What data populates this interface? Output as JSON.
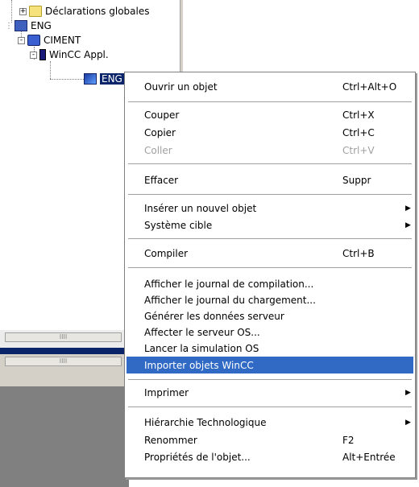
{
  "tree": {
    "nodes": [
      {
        "label": "Déclarations globales"
      },
      {
        "label": "ENG"
      },
      {
        "label": "CIMENT"
      },
      {
        "label": "WinCC Appl."
      },
      {
        "label": "ENG"
      }
    ],
    "expanders": [
      "+",
      "-",
      "-"
    ]
  },
  "panes": {
    "scroll_marks": [
      "IIII",
      "IIII"
    ]
  },
  "context_menu": {
    "items": [
      {
        "label": "Ouvrir un objet",
        "shortcut": "Ctrl+Alt+O"
      },
      {
        "label": "Couper",
        "shortcut": "Ctrl+X"
      },
      {
        "label": "Copier",
        "shortcut": "Ctrl+C"
      },
      {
        "label": "Coller",
        "shortcut": "Ctrl+V"
      },
      {
        "label": "Effacer",
        "shortcut": "Suppr"
      },
      {
        "label": "Insérer un nouvel objet",
        "arrow": "▶"
      },
      {
        "label": "Système cible",
        "arrow": "▶"
      },
      {
        "label": "Compiler",
        "shortcut": "Ctrl+B"
      },
      {
        "label": "Afficher le journal de compilation..."
      },
      {
        "label": "Afficher le journal du chargement..."
      },
      {
        "label": "Générer les données serveur"
      },
      {
        "label": "Affecter le serveur OS..."
      },
      {
        "label": "Lancer la simulation OS"
      },
      {
        "label": "Importer objets WinCC"
      },
      {
        "label": "Imprimer",
        "arrow": "▶"
      },
      {
        "label": "Hiérarchie Technologique",
        "arrow": "▶"
      },
      {
        "label": "Renommer",
        "shortcut": "F2"
      },
      {
        "label": "Propriétés de l'objet...",
        "shortcut": "Alt+Entrée"
      }
    ]
  },
  "colors": {
    "highlight": "#316ac5",
    "selection": "#0a246a",
    "disabled_text": "#a0a0a0"
  }
}
